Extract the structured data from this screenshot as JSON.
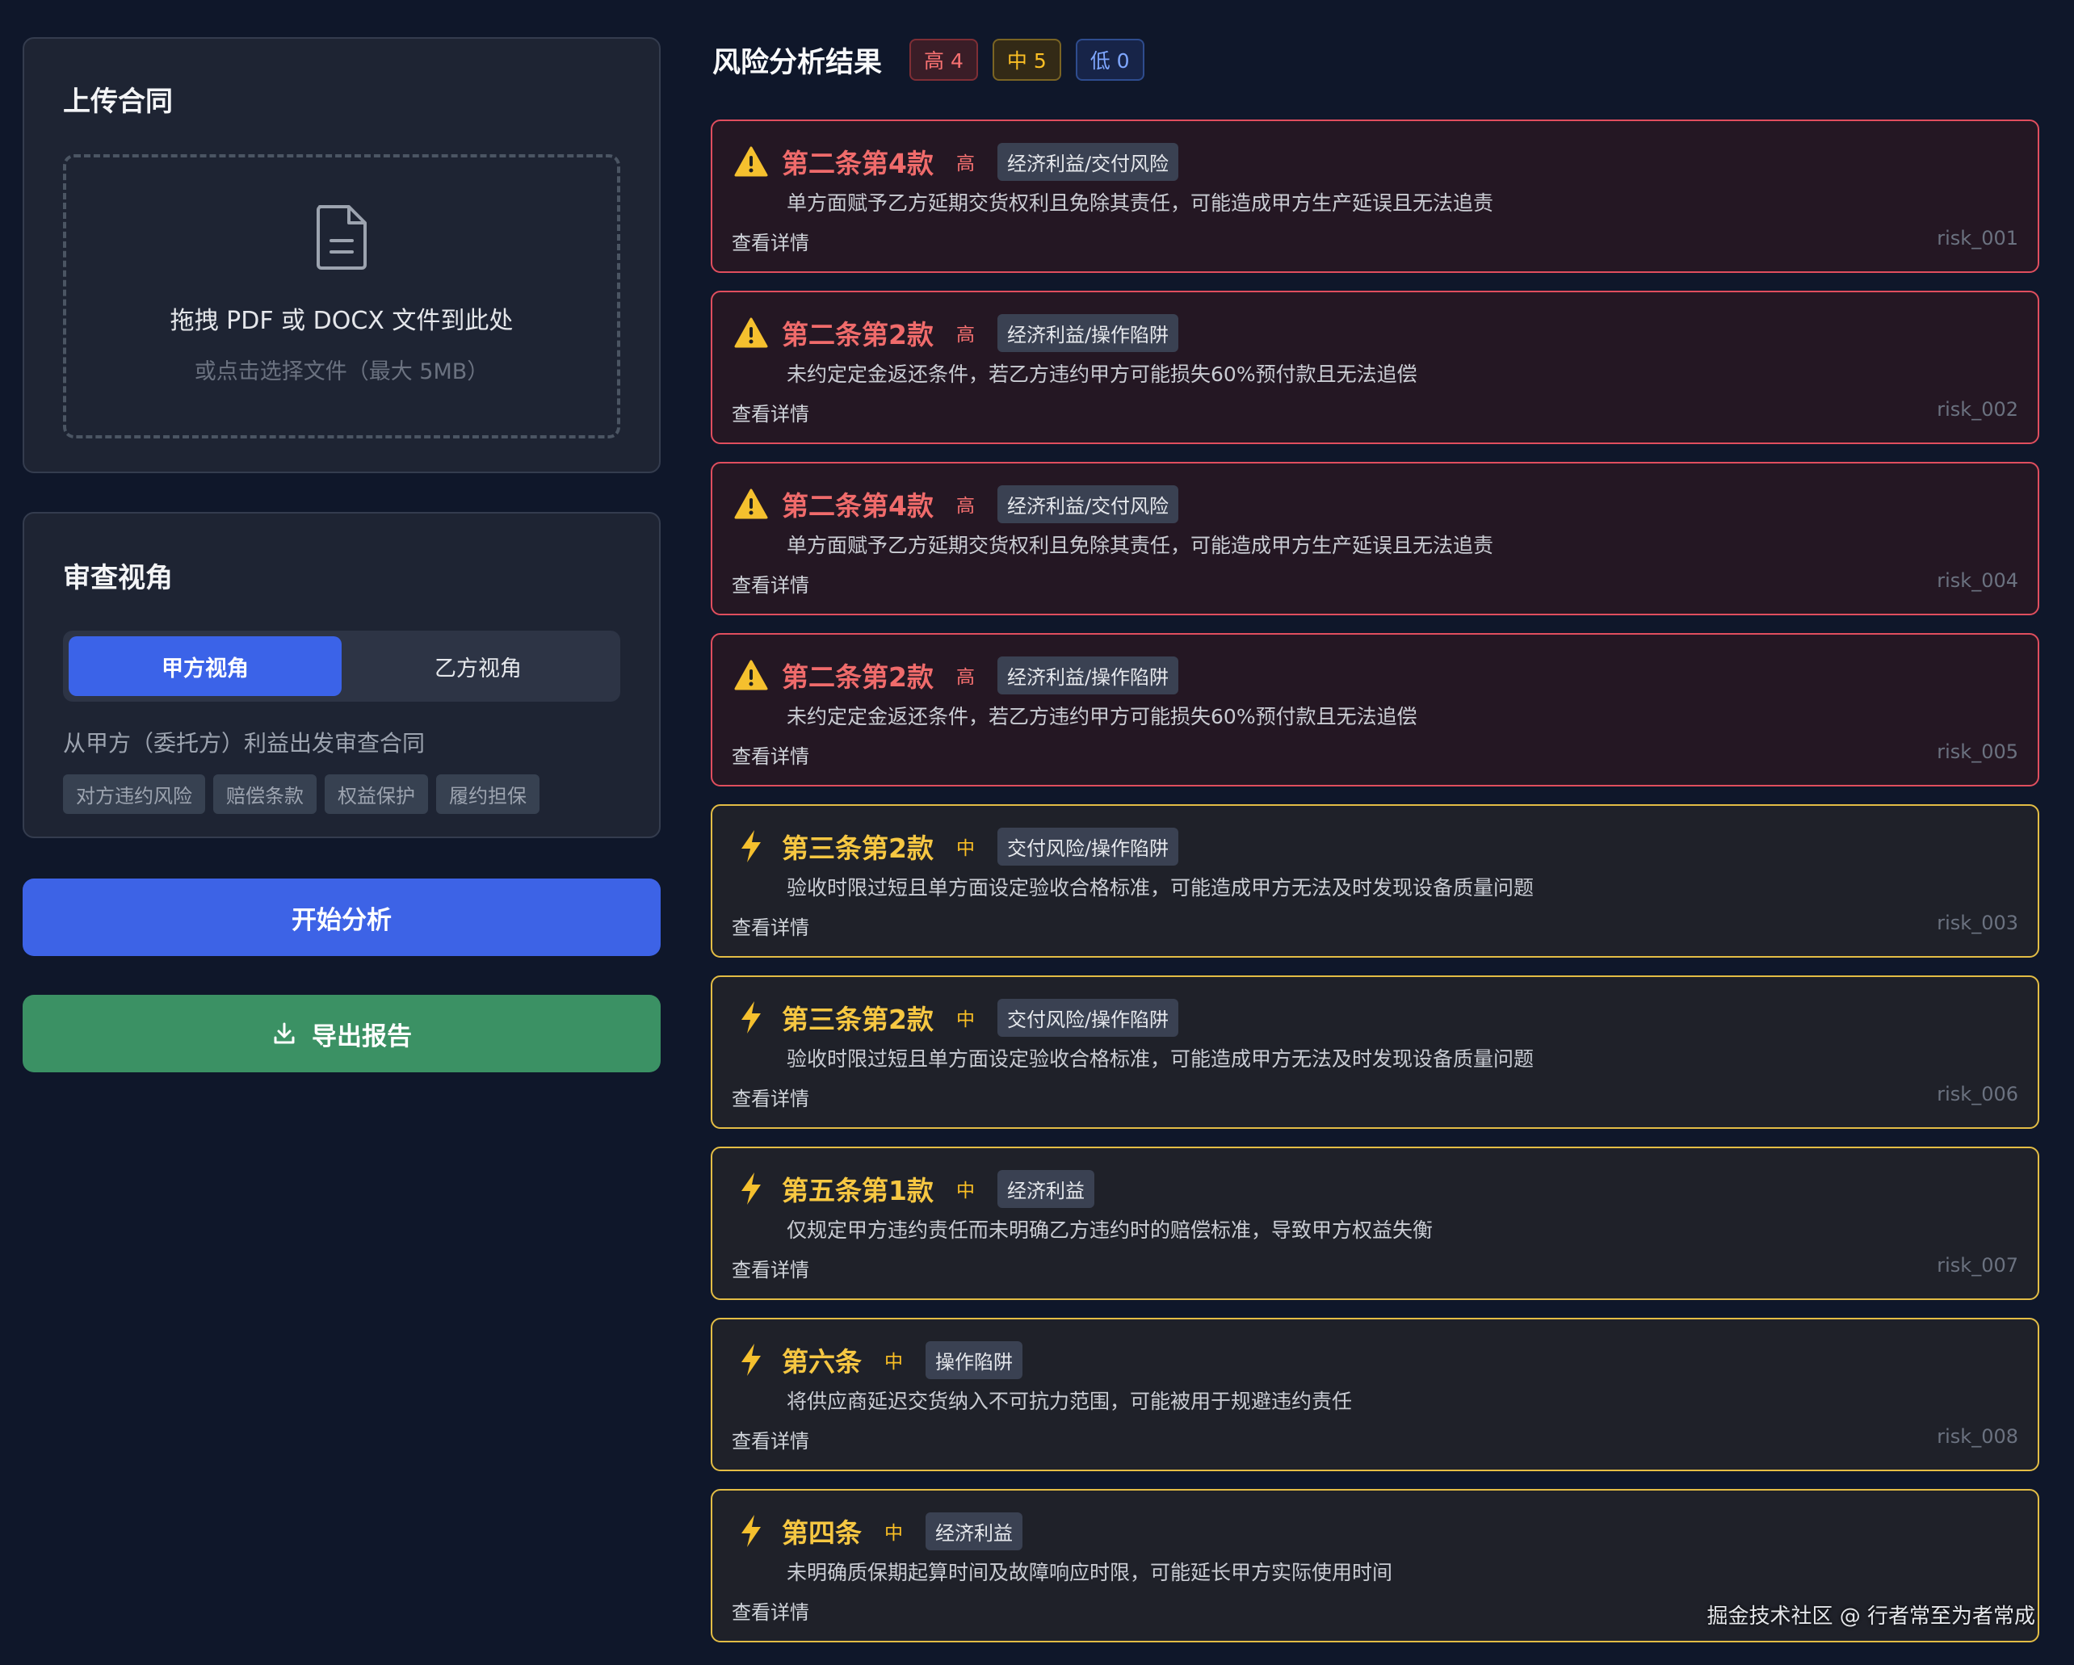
{
  "upload": {
    "title": "上传合同",
    "drop_main": "拖拽 PDF 或 DOCX 文件到此处",
    "drop_sub": "或点击选择文件（最大 5MB）"
  },
  "perspective": {
    "title": "审查视角",
    "options": [
      "甲方视角",
      "乙方视角"
    ],
    "selected": "甲方视角",
    "description": "从甲方（委托方）利益出发审查合同",
    "tags": [
      "对方违约风险",
      "赔偿条款",
      "权益保护",
      "履约担保"
    ]
  },
  "actions": {
    "start_label": "开始分析",
    "export_label": "导出报告"
  },
  "results": {
    "title": "风险分析结果",
    "badges": {
      "high": "高 4",
      "mid": "中 5",
      "low": "低 0"
    },
    "detail_label": "查看详情",
    "items": [
      {
        "clause": "第二条第4款",
        "level": "高",
        "severity": "high",
        "category": "经济利益/交付风险",
        "description": "单方面赋予乙方延期交货权利且免除其责任，可能造成甲方生产延误且无法追责",
        "id": "risk_001"
      },
      {
        "clause": "第二条第2款",
        "level": "高",
        "severity": "high",
        "category": "经济利益/操作陷阱",
        "description": "未约定定金返还条件，若乙方违约甲方可能损失60%预付款且无法追偿",
        "id": "risk_002"
      },
      {
        "clause": "第二条第4款",
        "level": "高",
        "severity": "high",
        "category": "经济利益/交付风险",
        "description": "单方面赋予乙方延期交货权利且免除其责任，可能造成甲方生产延误且无法追责",
        "id": "risk_004"
      },
      {
        "clause": "第二条第2款",
        "level": "高",
        "severity": "high",
        "category": "经济利益/操作陷阱",
        "description": "未约定定金返还条件，若乙方违约甲方可能损失60%预付款且无法追偿",
        "id": "risk_005"
      },
      {
        "clause": "第三条第2款",
        "level": "中",
        "severity": "mid",
        "category": "交付风险/操作陷阱",
        "description": "验收时限过短且单方面设定验收合格标准，可能造成甲方无法及时发现设备质量问题",
        "id": "risk_003"
      },
      {
        "clause": "第三条第2款",
        "level": "中",
        "severity": "mid",
        "category": "交付风险/操作陷阱",
        "description": "验收时限过短且单方面设定验收合格标准，可能造成甲方无法及时发现设备质量问题",
        "id": "risk_006"
      },
      {
        "clause": "第五条第1款",
        "level": "中",
        "severity": "mid",
        "category": "经济利益",
        "description": "仅规定甲方违约责任而未明确乙方违约时的赔偿标准，导致甲方权益失衡",
        "id": "risk_007"
      },
      {
        "clause": "第六条",
        "level": "中",
        "severity": "mid",
        "category": "操作陷阱",
        "description": "将供应商延迟交货纳入不可抗力范围，可能被用于规避违约责任",
        "id": "risk_008"
      },
      {
        "clause": "第四条",
        "level": "中",
        "severity": "mid",
        "category": "经济利益",
        "description": "未明确质保期起算时间及故障响应时限，可能延长甲方实际使用时间",
        "id": ""
      }
    ]
  },
  "watermark": "掘金技术社区 @ 行者常至为者常成"
}
